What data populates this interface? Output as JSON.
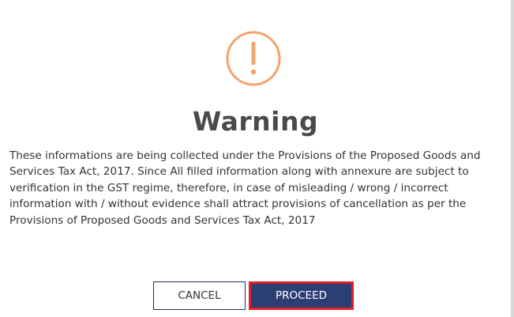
{
  "dialog": {
    "icon": "warning-exclamation-circle-icon",
    "accent_color": "#f3a36b",
    "title": "Warning",
    "message": "These informations are being collected under the Provisions of the Proposed Goods and Services Tax Act, 2017. Since All filled information along with annexure are subject to verification in the GST regime, therefore, in case of misleading / wrong / incorrect information with / without evidence shall attract provisions of cancellation as per the Provisions of Proposed Goods and Services Tax Act, 2017",
    "buttons": {
      "cancel_label": "CANCEL",
      "proceed_label": "PROCEED"
    },
    "colors": {
      "primary_button": "#2b3f74",
      "focus_outline": "#e01e26",
      "title_text": "#4a4a4a"
    }
  }
}
